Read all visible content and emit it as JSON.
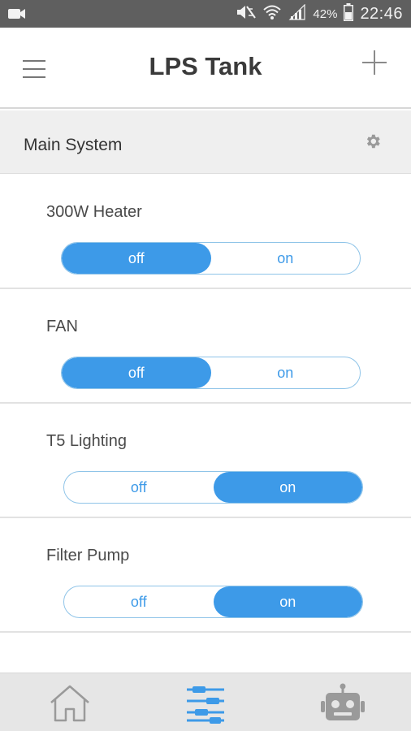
{
  "status_bar": {
    "battery_percent": "42%",
    "time": "22:46",
    "icons": [
      "video-camera-icon",
      "mute-icon",
      "wifi-icon",
      "signal-icon",
      "battery-icon"
    ]
  },
  "app_bar": {
    "title": "LPS Tank",
    "menu_icon": "hamburger-menu-icon",
    "add_icon": "plus-icon"
  },
  "section": {
    "title": "Main System",
    "settings_icon": "gear-icon"
  },
  "devices": [
    {
      "label": "300W Heater",
      "off_label": "off",
      "on_label": "on",
      "state": "off"
    },
    {
      "label": "FAN",
      "off_label": "off",
      "on_label": "on",
      "state": "off"
    },
    {
      "label": "T5 Lighting",
      "off_label": "off",
      "on_label": "on",
      "state": "on"
    },
    {
      "label": "Filter Pump",
      "off_label": "off",
      "on_label": "on",
      "state": "on"
    }
  ],
  "bottom_nav": {
    "items": [
      {
        "icon": "home-icon",
        "active": false
      },
      {
        "icon": "sliders-icon",
        "active": true
      },
      {
        "icon": "robot-icon",
        "active": false
      }
    ]
  },
  "colors": {
    "accent": "#3d9ae8",
    "status_bar": "#5f5f5f",
    "section_bg": "#efefef",
    "nav_bg": "#e6e6e6"
  }
}
